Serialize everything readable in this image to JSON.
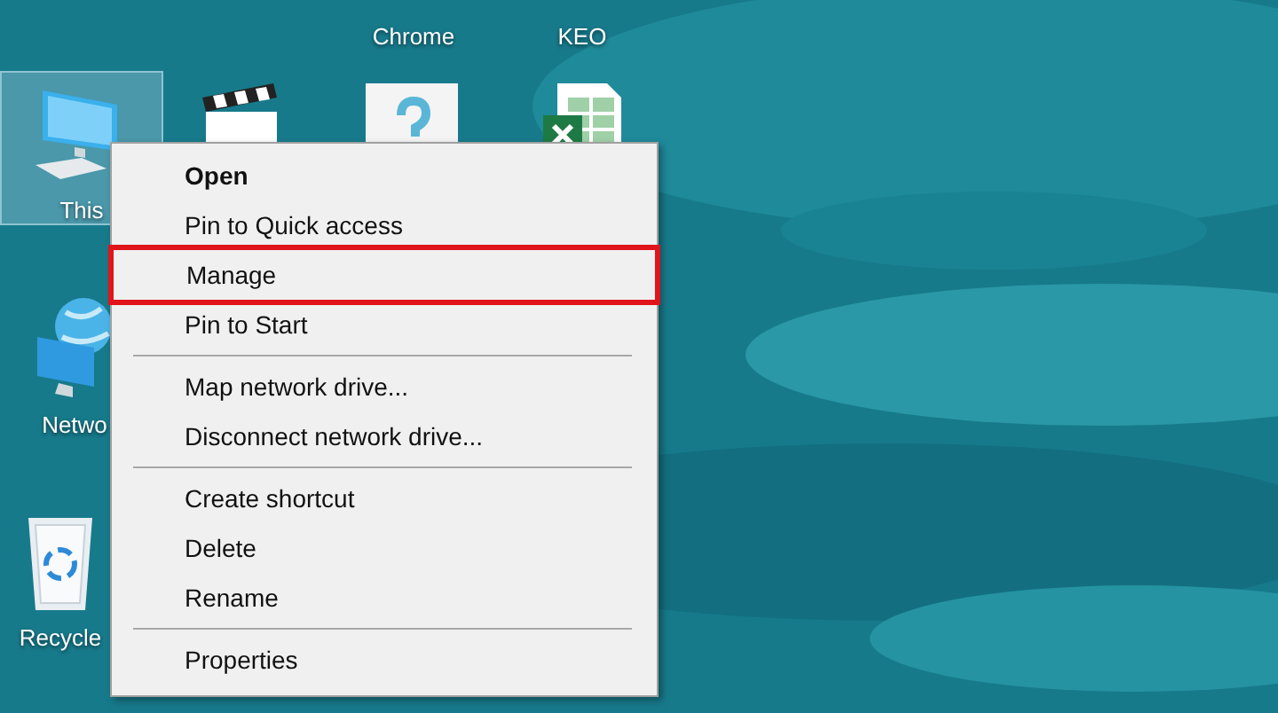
{
  "desktop": {
    "icons": [
      {
        "kind": "label_only",
        "label": "Chrome",
        "selected": false
      },
      {
        "kind": "label_only",
        "label": "KEO",
        "selected": false
      },
      {
        "kind": "computer",
        "label": "This",
        "selected": true
      },
      {
        "kind": "video",
        "selected": false
      },
      {
        "kind": "unknown_file",
        "selected": false
      },
      {
        "kind": "spreadsheet",
        "selected": false
      },
      {
        "kind": "network",
        "label": "Netwo",
        "selected": false
      },
      {
        "kind": "recycle_bin",
        "label": "Recycle",
        "selected": false
      }
    ]
  },
  "context_menu": {
    "items": [
      {
        "kind": "item",
        "label": "Open",
        "bold": true,
        "highlighted": false
      },
      {
        "kind": "item",
        "label": "Pin to Quick access",
        "bold": false,
        "highlighted": false
      },
      {
        "kind": "item",
        "label": "Manage",
        "bold": false,
        "highlighted": true
      },
      {
        "kind": "item",
        "label": "Pin to Start",
        "bold": false,
        "highlighted": false
      },
      {
        "kind": "separator"
      },
      {
        "kind": "item",
        "label": "Map network drive...",
        "bold": false,
        "highlighted": false
      },
      {
        "kind": "item",
        "label": "Disconnect network drive...",
        "bold": false,
        "highlighted": false
      },
      {
        "kind": "separator"
      },
      {
        "kind": "item",
        "label": "Create shortcut",
        "bold": false,
        "highlighted": false
      },
      {
        "kind": "item",
        "label": "Delete",
        "bold": false,
        "highlighted": false
      },
      {
        "kind": "item",
        "label": "Rename",
        "bold": false,
        "highlighted": false
      },
      {
        "kind": "separator"
      },
      {
        "kind": "item",
        "label": "Properties",
        "bold": false,
        "highlighted": false
      }
    ]
  }
}
